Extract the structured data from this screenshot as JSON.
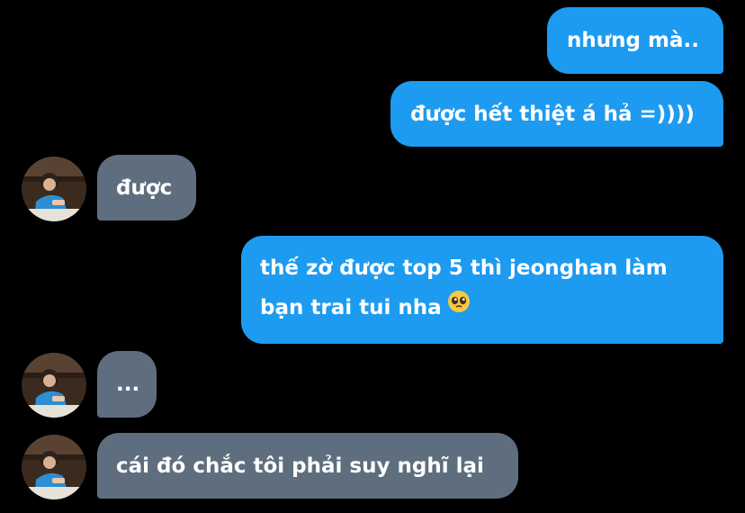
{
  "chat": {
    "messages": [
      {
        "sender": "me",
        "text": "nhưng mà.."
      },
      {
        "sender": "me",
        "text": "được hết thiệt á hả =))))"
      },
      {
        "sender": "other",
        "text": "được"
      },
      {
        "sender": "me",
        "text_line1": "thế zờ được top 5 thì jeonghan làm",
        "text_line2": "bạn trai tui nha",
        "emoji": "pleading-face-icon"
      },
      {
        "sender": "other",
        "text": "..."
      },
      {
        "sender": "other",
        "text": "cái đó chắc tôi phải suy nghĩ lại"
      }
    ]
  },
  "colors": {
    "background": "#000000",
    "sent_bubble": "#1d9bf0",
    "received_bubble": "#5f6e7e",
    "text": "#ffffff"
  }
}
